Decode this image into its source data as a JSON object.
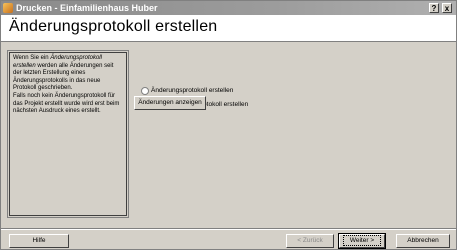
{
  "window": {
    "title": "Drucken - Einfamilienhaus Huber",
    "help_button": "?",
    "close_button": "x"
  },
  "page": {
    "title": "Änderungsprotokoll erstellen"
  },
  "info": {
    "line1_prefix": "Wenn Sie ein ",
    "line1_em": "Änderungsprotokoll erstellen",
    "line1_rest": " werden alle Änderungen seit der letzten Erstellung eines Änderungsprotokolls in das neue Protokoll geschrieben.",
    "line2": "Falls noch kein Änderungsprotokoll für das Projekt erstellt wurde wird erst beim nächsten Ausdruck eines erstellt."
  },
  "options": {
    "create_label": "Änderungsprotokoll erstellen",
    "none_label": "Kein Änderungsprotokoll erstellen",
    "selected": "none"
  },
  "buttons": {
    "show_changes": "Änderungen anzeigen",
    "help": "Hilfe",
    "back": "< Zurück",
    "next": "Weiter >",
    "cancel": "Abbrechen"
  }
}
